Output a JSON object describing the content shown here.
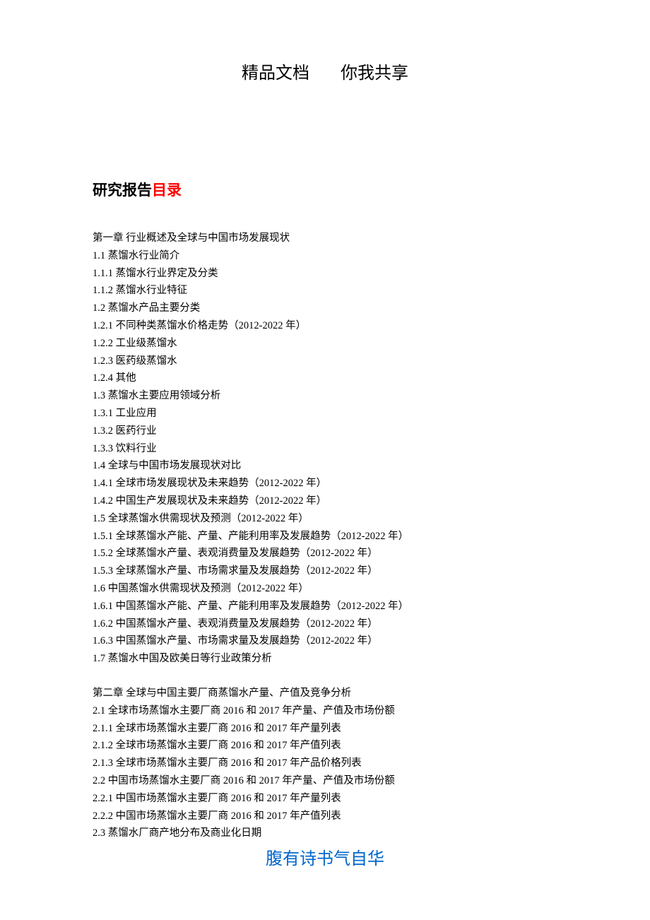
{
  "header": {
    "left": "精品文档",
    "right": "你我共享"
  },
  "title": {
    "prefix": "研究报告",
    "suffix": "目录"
  },
  "toc": {
    "chapter1": {
      "heading": "第一章 行业概述及全球与中国市场发展现状",
      "items": [
        "1.1 蒸馏水行业简介",
        "1.1.1 蒸馏水行业界定及分类",
        "1.1.2 蒸馏水行业特征",
        "1.2 蒸馏水产品主要分类",
        "1.2.1 不同种类蒸馏水价格走势（2012-2022 年）",
        "1.2.2 工业级蒸馏水",
        "1.2.3 医药级蒸馏水",
        "1.2.4 其他",
        "1.3 蒸馏水主要应用领域分析",
        "1.3.1 工业应用",
        "1.3.2 医药行业",
        "1.3.3 饮料行业",
        "1.4 全球与中国市场发展现状对比",
        "1.4.1 全球市场发展现状及未来趋势（2012-2022 年）",
        "1.4.2 中国生产发展现状及未来趋势（2012-2022 年）",
        "1.5 全球蒸馏水供需现状及预测（2012-2022 年）",
        "1.5.1 全球蒸馏水产能、产量、产能利用率及发展趋势（2012-2022 年）",
        "1.5.2 全球蒸馏水产量、表观消费量及发展趋势（2012-2022 年）",
        "1.5.3 全球蒸馏水产量、市场需求量及发展趋势（2012-2022 年）",
        "1.6 中国蒸馏水供需现状及预测（2012-2022 年）",
        "1.6.1 中国蒸馏水产能、产量、产能利用率及发展趋势（2012-2022 年）",
        "1.6.2 中国蒸馏水产量、表观消费量及发展趋势（2012-2022 年）",
        "1.6.3 中国蒸馏水产量、市场需求量及发展趋势（2012-2022 年）",
        "1.7 蒸馏水中国及欧美日等行业政策分析"
      ]
    },
    "chapter2": {
      "heading": "第二章 全球与中国主要厂商蒸馏水产量、产值及竞争分析",
      "items": [
        "2.1 全球市场蒸馏水主要厂商 2016 和 2017 年产量、产值及市场份额",
        "2.1.1 全球市场蒸馏水主要厂商 2016 和 2017 年产量列表",
        "2.1.2 全球市场蒸馏水主要厂商 2016 和 2017 年产值列表",
        "2.1.3 全球市场蒸馏水主要厂商 2016 和 2017 年产品价格列表",
        "2.2 中国市场蒸馏水主要厂商 2016 和 2017 年产量、产值及市场份额",
        "2.2.1 中国市场蒸馏水主要厂商 2016 和 2017 年产量列表",
        "2.2.2 中国市场蒸馏水主要厂商 2016 和 2017 年产值列表",
        "2.3 蒸馏水厂商产地分布及商业化日期"
      ]
    }
  },
  "footer": "腹有诗书气自华"
}
